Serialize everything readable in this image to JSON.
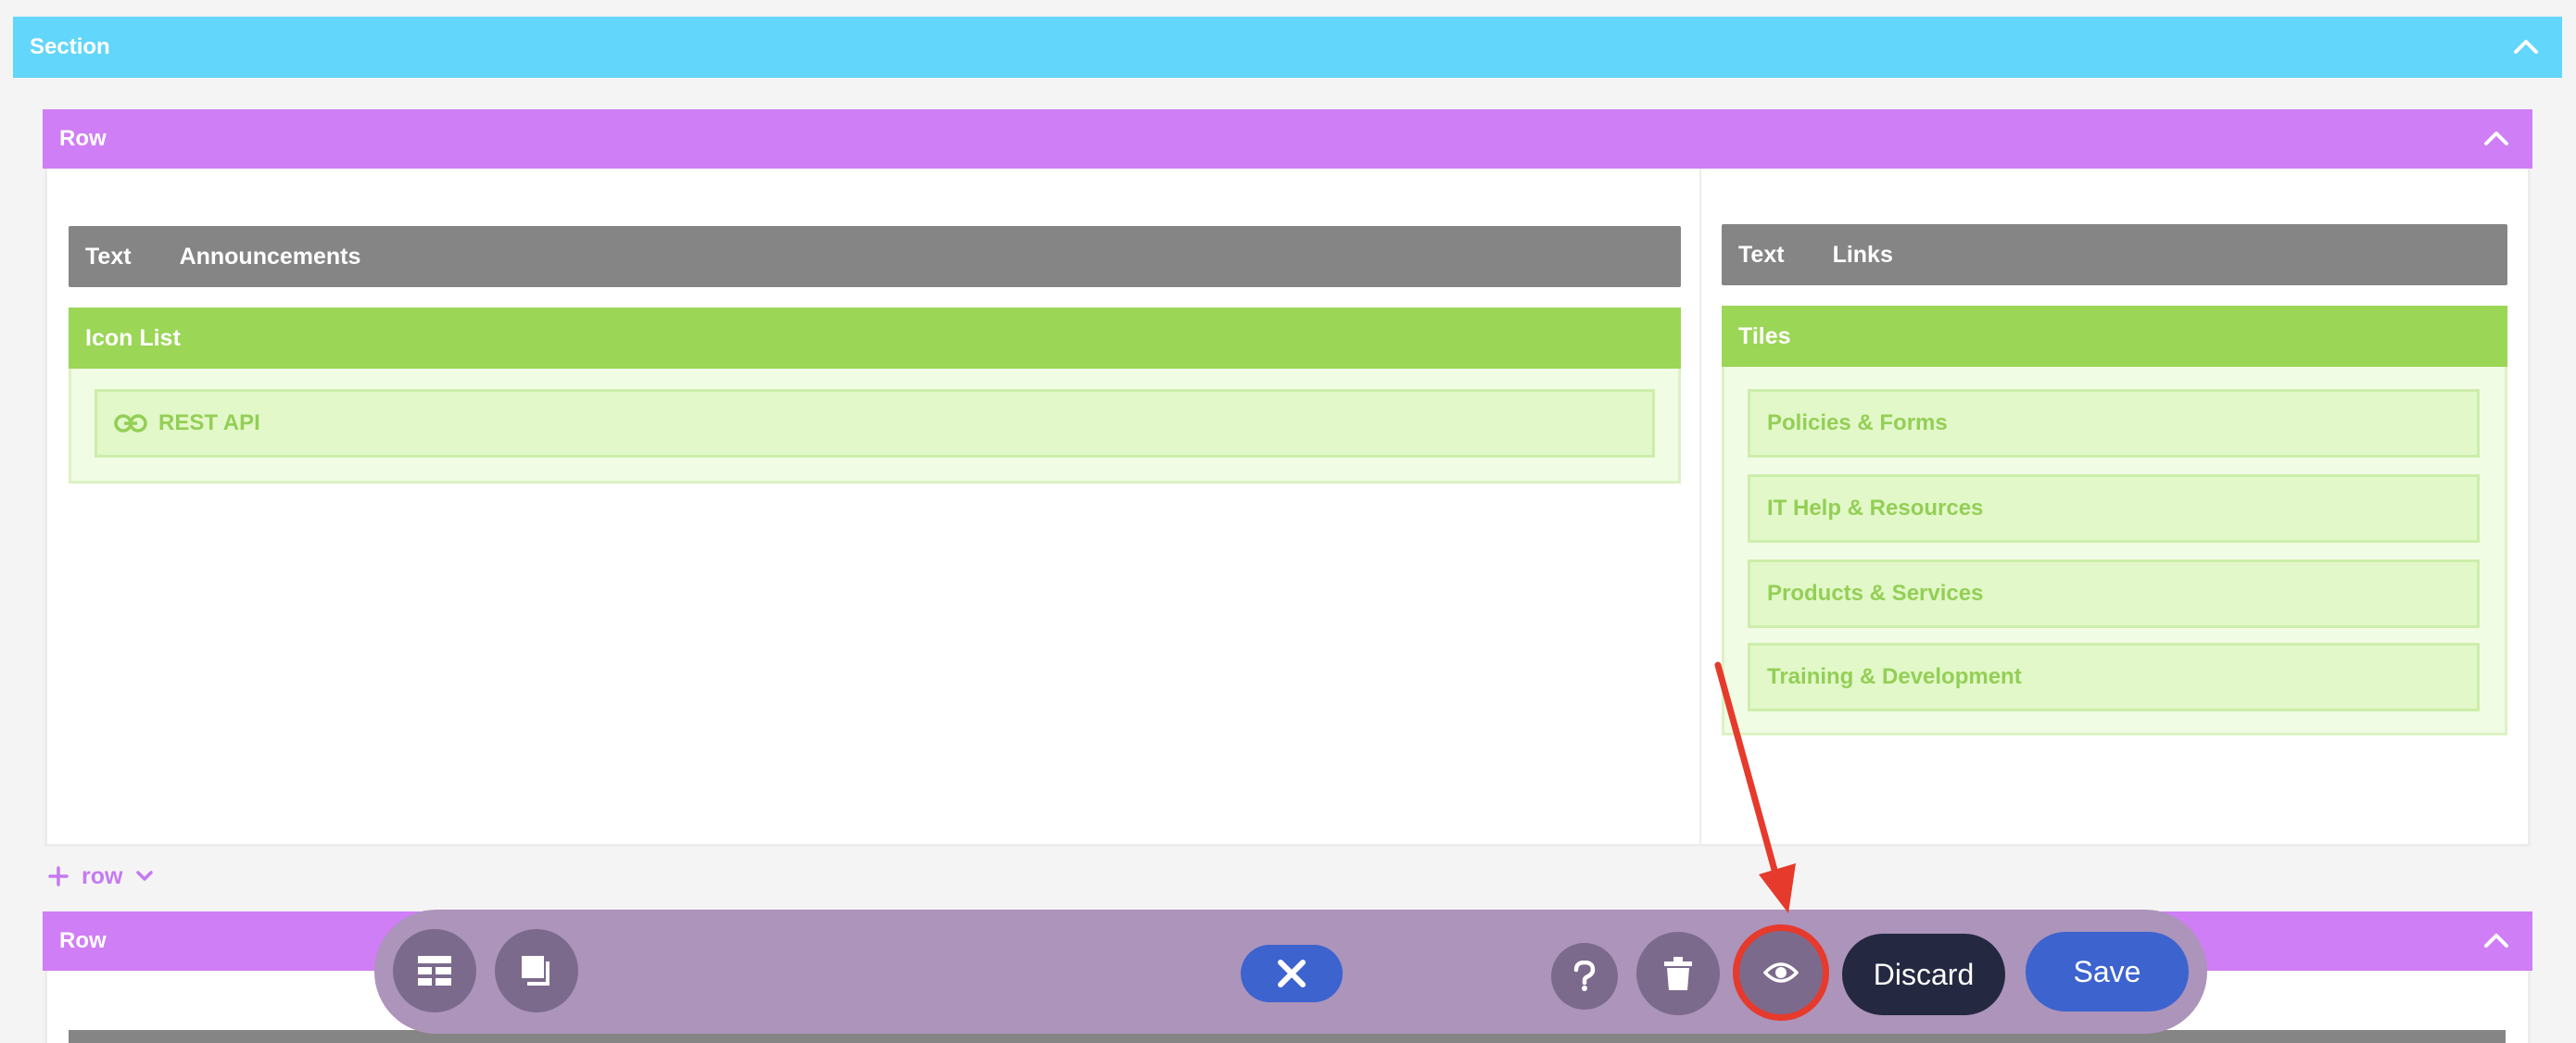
{
  "section": {
    "label": "Section"
  },
  "row1": {
    "label": "Row",
    "left_col": {
      "text_module": {
        "type": "Text",
        "title": "Announcements"
      },
      "icon_list": {
        "label": "Icon List",
        "items": [
          "REST API"
        ]
      }
    },
    "right_col": {
      "text_module": {
        "type": "Text",
        "title": "Links"
      },
      "tiles": {
        "label": "Tiles",
        "items": [
          "Policies & Forms",
          "IT Help & Resources",
          "Products & Services",
          "Training & Development"
        ]
      }
    }
  },
  "add_row": {
    "label": "row"
  },
  "row2": {
    "label": "Row"
  },
  "toolbar": {
    "discard_label": "Discard",
    "save_label": "Save",
    "icons": [
      "layout-icon",
      "copy-icon",
      "close-icon",
      "help-icon",
      "trash-icon",
      "eye-icon"
    ]
  },
  "colors": {
    "section": "#62d6fb",
    "row": "#cf7ef5",
    "text_module": "#858585",
    "green_module": "#9bd656",
    "toolbar": "#ac94bb",
    "primary": "#3d63ce",
    "dark": "#242840",
    "annotation": "#e63a2c"
  }
}
